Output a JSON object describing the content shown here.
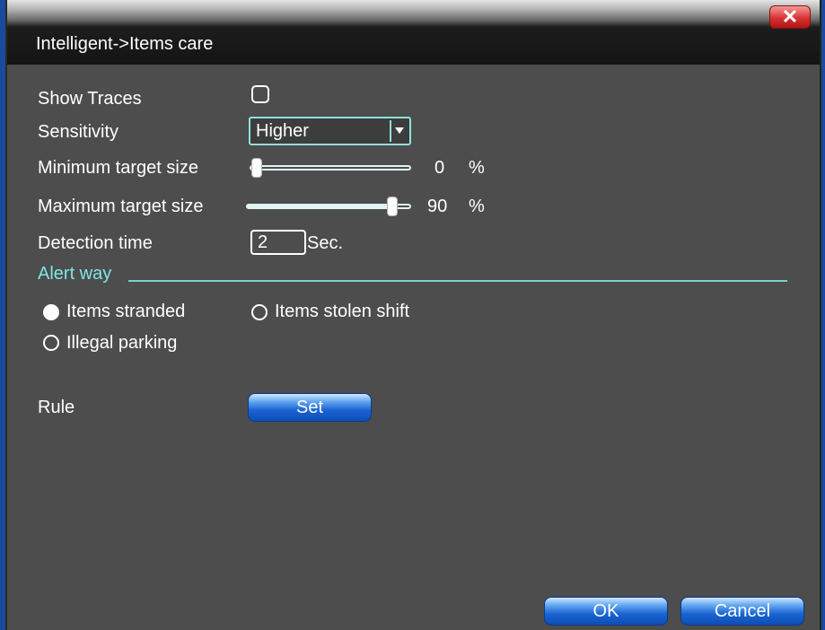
{
  "window": {
    "title": "Intelligent->Items care",
    "close_label": "✕"
  },
  "show_traces": {
    "label": "Show Traces",
    "checked": false
  },
  "sensitivity": {
    "label": "Sensitivity",
    "value": "Higher"
  },
  "min_target": {
    "label": "Minimum target size",
    "value": "0",
    "unit": "%",
    "fraction": 0
  },
  "max_target": {
    "label": "Maximum target size",
    "value": "90",
    "unit": "%",
    "fraction": 0.9
  },
  "detection_time": {
    "label": "Detection time",
    "value": "2",
    "unit": "Sec."
  },
  "alert": {
    "heading": "Alert way",
    "options": [
      {
        "label": "Items stranded",
        "selected": true
      },
      {
        "label": "Items stolen shift",
        "selected": false
      },
      {
        "label": "Illegal parking",
        "selected": false
      }
    ]
  },
  "rule": {
    "label": "Rule",
    "button": "Set"
  },
  "footer": {
    "ok": "OK",
    "cancel": "Cancel"
  },
  "colors": {
    "accent": "#7fe6e6",
    "panel": "#4c4d4c",
    "button": "#1a64d2"
  }
}
